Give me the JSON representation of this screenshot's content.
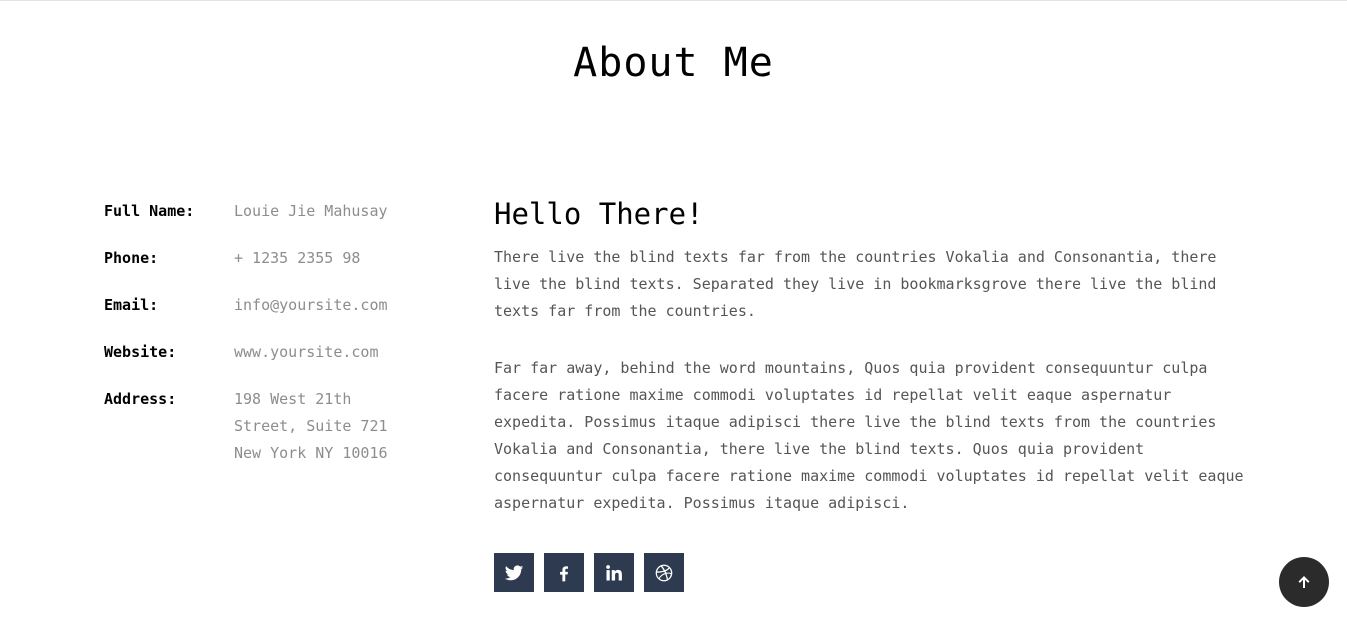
{
  "section": {
    "title": "About Me"
  },
  "info": [
    {
      "label": "Full Name:",
      "value": "Louie Jie Mahusay"
    },
    {
      "label": "Phone:",
      "value": "+ 1235 2355 98"
    },
    {
      "label": "Email:",
      "value": "info@yoursite.com"
    },
    {
      "label": "Website:",
      "value": "www.yoursite.com"
    },
    {
      "label": "Address:",
      "value": "198 West 21th\nStreet, Suite 721\nNew York NY 10016"
    }
  ],
  "content": {
    "heading": "Hello There!",
    "paragraph1": "There live the blind texts far from the countries Vokalia and Consonantia, there live the blind texts. Separated they live in bookmarksgrove there live the blind texts far from the countries.",
    "paragraph2": "Far far away, behind the word mountains, Quos quia provident consequuntur culpa facere ratione maxime commodi voluptates id repellat velit eaque aspernatur expedita. Possimus itaque adipisci there live the blind texts from the countries Vokalia and Consonantia, there live the blind texts. Quos quia provident consequuntur culpa facere ratione maxime commodi voluptates id repellat velit eaque aspernatur expedita. Possimus itaque adipisci."
  },
  "socials": [
    "twitter-icon",
    "facebook-icon",
    "linkedin-icon",
    "dribbble-icon"
  ],
  "colors": {
    "social_bg": "#2d3a4f",
    "to_top_bg": "#2b2b2b",
    "muted_text": "#8d8d8d",
    "body_text": "#555555"
  },
  "to_top": {
    "icon": "arrow-up-icon"
  }
}
